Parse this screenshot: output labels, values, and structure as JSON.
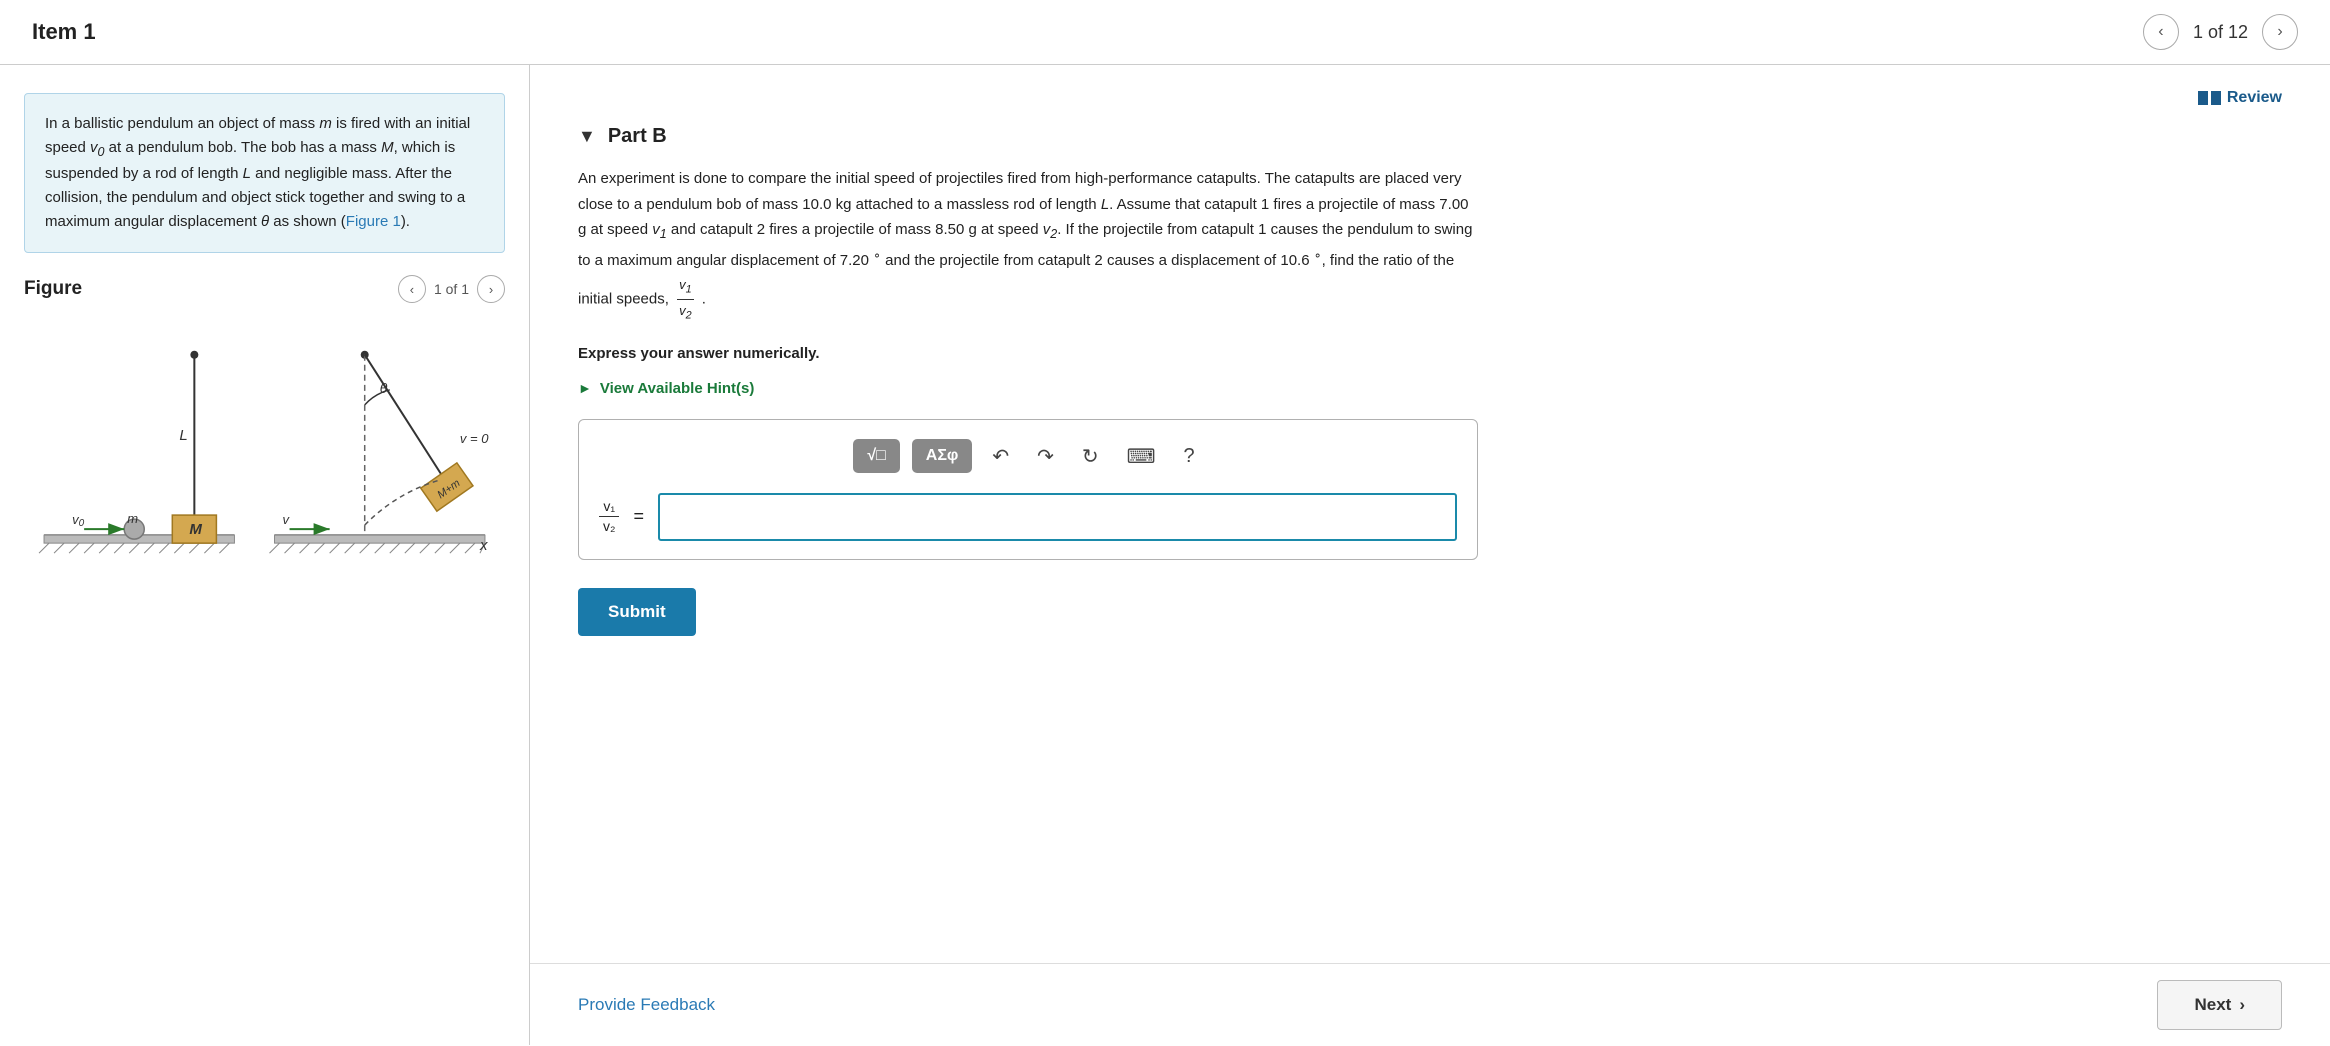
{
  "header": {
    "item_title": "Item 1",
    "page_current": "1",
    "page_total": "12",
    "page_display": "1 of 12"
  },
  "left": {
    "problem_description": "In a ballistic pendulum an object of mass m is fired with an initial speed v₀ at a pendulum bob. The bob has a mass M, which is suspended by a rod of length L and negligible mass. After the collision, the pendulum and object stick together and swing to a maximum angular displacement θ as shown (Figure 1).",
    "figure_link_text": "Figure 1",
    "figure_title": "Figure",
    "figure_nav": "1 of 1"
  },
  "right": {
    "review_label": "Review",
    "part_title": "Part B",
    "problem_text_1": "An experiment is done to compare the initial speed of projectiles fired from high-performance catapults. The catapults are placed very close to a pendulum bob of mass 10.0 kg attached to a massless rod of length L. Assume that catapult 1 fires a projectile of mass 7.00 g at speed v₁ and catapult 2 fires a projectile of mass 8.50 g at speed v₂. If the projectile from catapult 1 causes the pendulum to swing to a maximum angular displacement of 7.20° and the projectile from catapult 2 causes a displacement of 10.6°, find the ratio of the initial speeds, v₁/v₂.",
    "express_answer": "Express your answer numerically.",
    "hint_label": "View Available Hint(s)",
    "toolbar": {
      "math_btn": "√□",
      "greek_btn": "AΣφ",
      "undo_icon": "↶",
      "redo_icon": "↷",
      "refresh_icon": "⟳",
      "keyboard_icon": "⌨",
      "help_icon": "?"
    },
    "fraction_numerator": "v₁",
    "fraction_denominator": "v₂",
    "equals": "=",
    "submit_label": "Submit"
  },
  "footer": {
    "provide_feedback_label": "Provide Feedback",
    "next_label": "Next"
  }
}
